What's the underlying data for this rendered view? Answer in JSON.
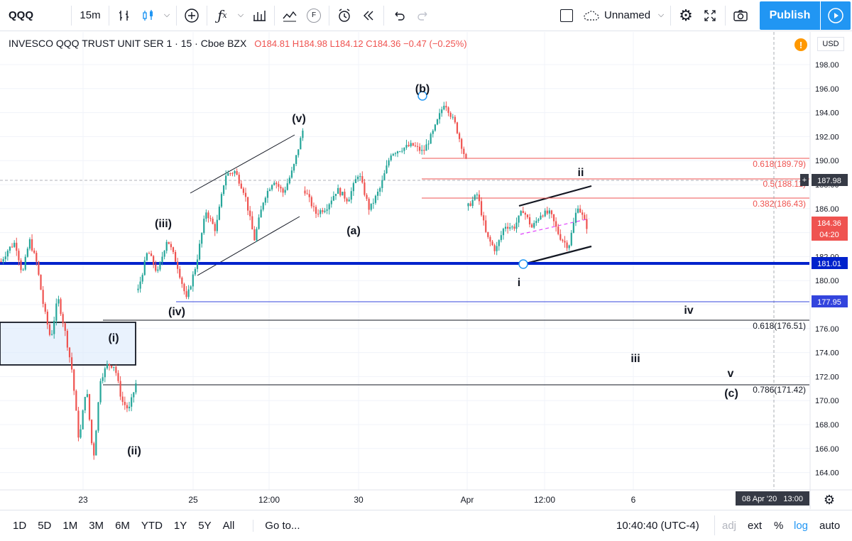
{
  "toolbar": {
    "symbol": "QQQ",
    "interval": "15m",
    "layout_name": "Unnamed",
    "publish_label": "Publish",
    "indicator_f": "F"
  },
  "legend": {
    "title": "INVESCO QQQ TRUST UNIT SER 1 · 15 · Cboe BZX",
    "open": "O184.81",
    "high": "H184.98",
    "low": "L184.12",
    "close": "C184.36",
    "change": "−0.47 (−0.25%)"
  },
  "currency": "USD",
  "colors": {
    "accent": "#2196f3",
    "up": "#26a69a",
    "down": "#ef5350",
    "support_line": "#0022cc",
    "fib_red": "#ef5350",
    "warn": "#ff9800"
  },
  "chart_data": {
    "type": "candlestick",
    "y_axis": {
      "ylim": [
        163.2,
        199.8
      ],
      "ticks": [
        "198.00",
        "196.00",
        "194.00",
        "192.00",
        "190.00",
        "188.00",
        "186.00",
        "184.00",
        "182.00",
        "180.00",
        "178.00",
        "176.00",
        "174.00",
        "172.00",
        "170.00",
        "168.00",
        "166.00",
        "164.00"
      ]
    },
    "x_axis": {
      "ticks": [
        "23",
        "25",
        "12:00",
        "30",
        "Apr",
        "12:00",
        "6"
      ],
      "crosshair_label": "08 Apr '20   13:00"
    },
    "price_labels": {
      "crosshair": "187.98",
      "last": "184.36",
      "countdown": "04:20",
      "support": "181.01",
      "level2": "177.95"
    },
    "fib_levels": [
      {
        "label": "0.618(189.79)",
        "value": 189.79
      },
      {
        "label": "0.5(188.11)",
        "value": 188.11
      },
      {
        "label": "0.382(186.43)",
        "value": 186.43
      },
      {
        "label": "0.618(176.51)",
        "value": 176.51
      },
      {
        "label": "0.786(171.42)",
        "value": 171.42
      }
    ],
    "wave_labels": [
      "(v)",
      "(b)",
      "(iii)",
      "(a)",
      "ii",
      "i",
      "(iv)",
      "iv",
      "(i)",
      "iii",
      "v",
      "(c)",
      "(ii)"
    ],
    "candle_pivots": [
      181.6,
      182.6,
      183.2,
      180.5,
      183.4,
      181.5,
      177.8,
      175.1,
      178.6,
      175.8,
      172.5,
      166.5,
      171.3,
      165.0,
      171.8,
      173.0,
      172.9,
      170.0,
      169.2,
      171.4,
      179.2,
      182.5,
      180.6,
      183.5,
      181.4,
      178.4,
      181.4,
      185.8,
      184.2,
      188.8,
      189.1,
      187.3,
      183.4,
      186.9,
      188.4,
      187.3,
      189.3,
      192.5,
      187.5,
      185.6,
      186.1,
      187.6,
      186.7,
      189.0,
      185.9,
      187.7,
      190.6,
      191.0,
      191.3,
      190.7,
      192.5,
      194.9,
      193.0,
      190.0,
      186.2,
      187.2,
      183.7,
      182.5,
      184.6,
      184.4,
      185.9,
      184.4,
      185.6,
      185.6,
      183.7,
      182.8,
      186.3,
      184.5
    ]
  },
  "bottombar": {
    "ranges": [
      "1D",
      "5D",
      "1M",
      "3M",
      "6M",
      "YTD",
      "1Y",
      "5Y",
      "All"
    ],
    "goto": "Go to...",
    "clock": "10:40:40 (UTC-4)",
    "adj": "adj",
    "ext": "ext",
    "percent": "%",
    "log": "log",
    "auto": "auto"
  }
}
